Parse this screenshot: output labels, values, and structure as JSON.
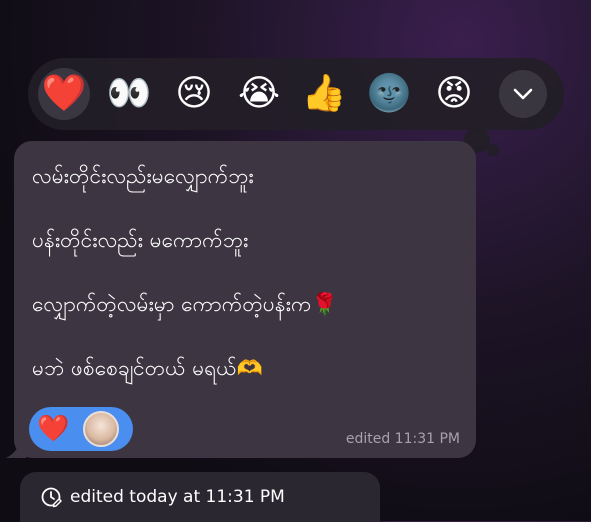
{
  "reactions": [
    {
      "emoji": "❤️",
      "name": "heart",
      "selected": true
    },
    {
      "emoji": "👀",
      "name": "eyes",
      "selected": false
    },
    {
      "emoji": "😢",
      "name": "crying-face",
      "selected": false
    },
    {
      "emoji": "😭",
      "name": "loudly-crying-face",
      "selected": false
    },
    {
      "emoji": "👍",
      "name": "thumbs-up",
      "selected": false
    },
    {
      "emoji": "🌚",
      "name": "new-moon-face",
      "selected": false
    },
    {
      "emoji": "😡",
      "name": "pouting-face",
      "selected": false
    }
  ],
  "message": {
    "lines": [
      "လမ်းတိုင်းလည်းမလျှောက်ဘူး",
      "ပန်းတိုင်းလည်း မကောက်ဘူး",
      "လျှောက်တဲ့လမ်းမှာ ကောက်တဲ့ပန်းက🌹",
      "မဘဲ ဖစ်စေချင်တယ် မရယ်🫶"
    ],
    "reaction_emoji": "❤️",
    "edited_label": "edited 11:31 PM"
  },
  "edit_info": {
    "label": "edited today at 11:31 PM"
  },
  "colors": {
    "bubble": "#3d3642",
    "reaction_pill": "#4a8ff0",
    "bar": "#221e28"
  }
}
